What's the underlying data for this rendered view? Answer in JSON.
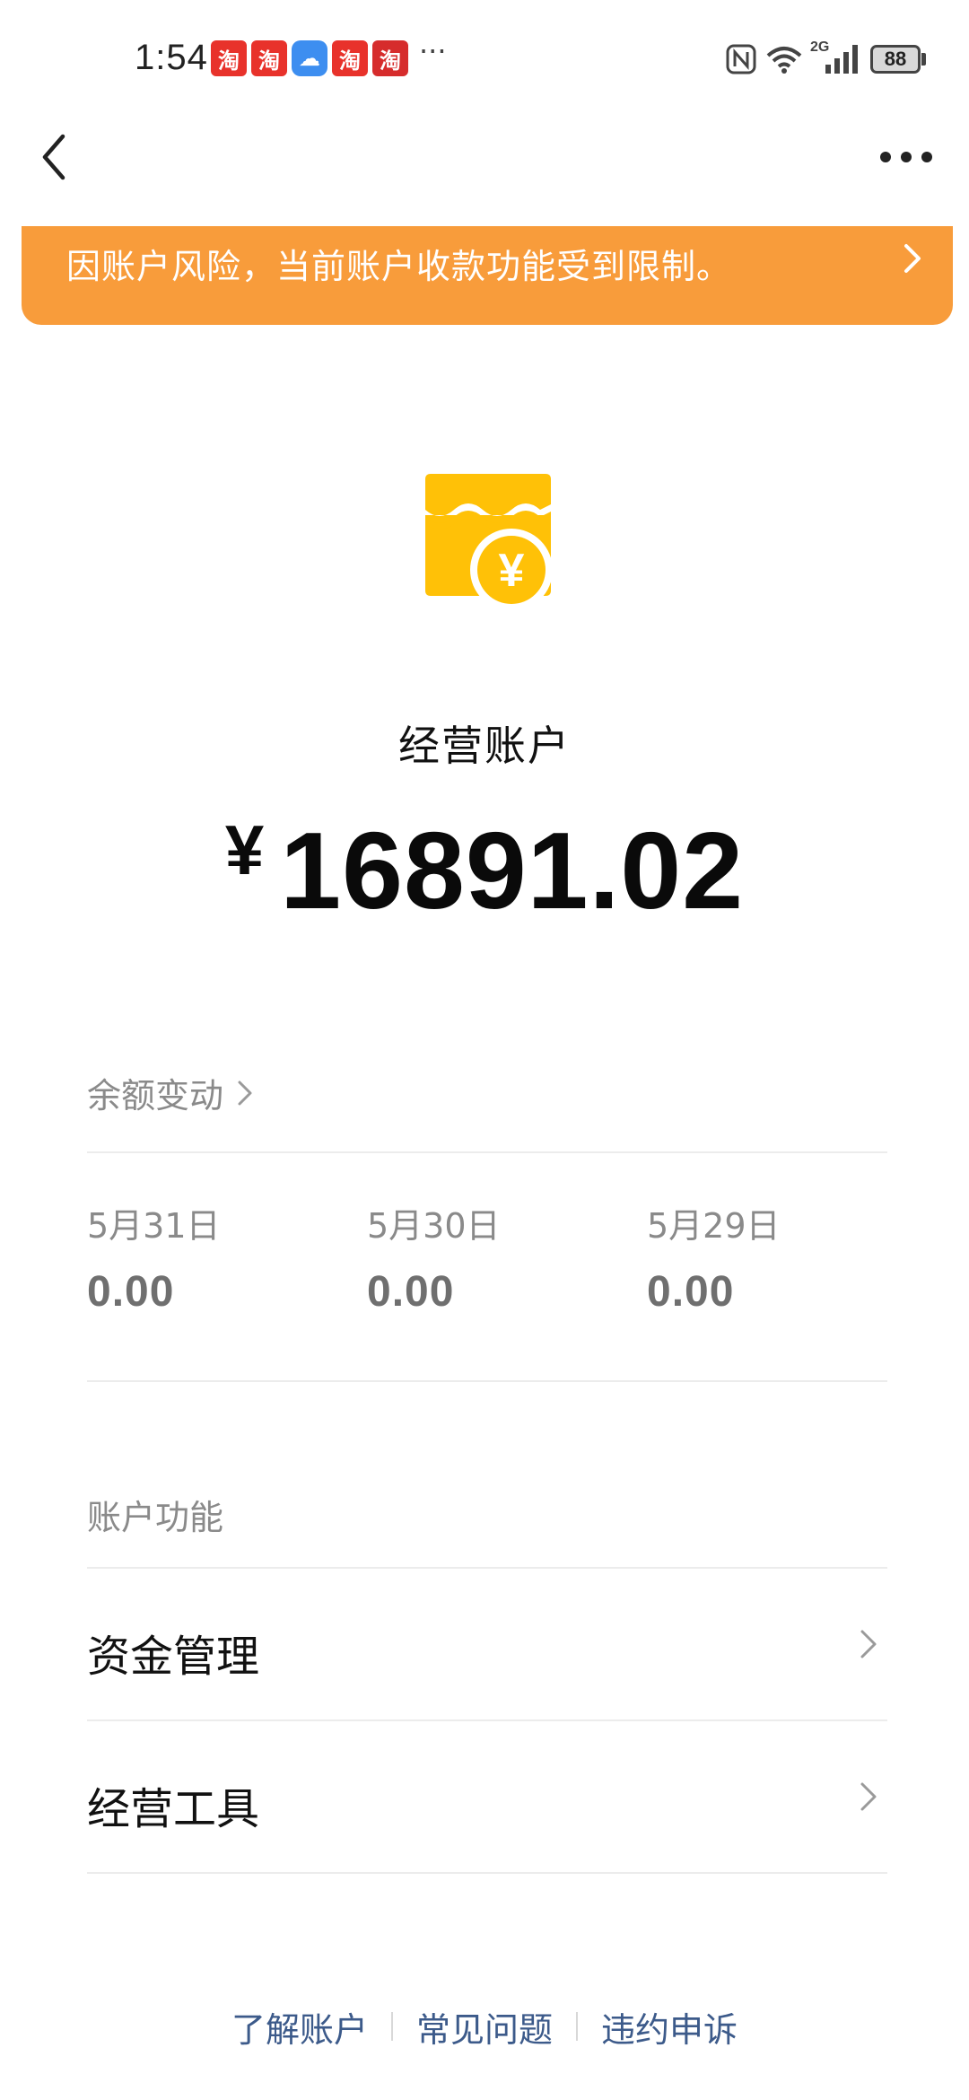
{
  "status_bar": {
    "time": "1:54",
    "notifications": [
      {
        "name": "taobao-618-icon",
        "glyph": "淘",
        "color": "#e8322b"
      },
      {
        "name": "taobao-618-icon",
        "glyph": "淘",
        "color": "#e8322b"
      },
      {
        "name": "cloud-app-icon",
        "glyph": "☁",
        "color": "#3d8ef0"
      },
      {
        "name": "taobao-618-icon",
        "glyph": "淘",
        "color": "#e8322b"
      },
      {
        "name": "taobao-icon",
        "glyph": "淘",
        "color": "#d62c2c"
      }
    ],
    "more": "···",
    "network": "2G",
    "battery": "88"
  },
  "warning": {
    "text": "因账户风险，当前账户收款功能受到限制。"
  },
  "account": {
    "title": "经营账户",
    "currency": "¥",
    "balance": "16891.02"
  },
  "balance_changes": {
    "label": "余额变动",
    "days": [
      {
        "date": "5月31日",
        "value": "0.00"
      },
      {
        "date": "5月30日",
        "value": "0.00"
      },
      {
        "date": "5月29日",
        "value": "0.00"
      }
    ]
  },
  "features": {
    "title": "账户功能",
    "items": [
      {
        "label": "资金管理"
      },
      {
        "label": "经营工具"
      }
    ]
  },
  "footer": {
    "links": [
      "了解账户",
      "常见问题",
      "违约申诉"
    ]
  },
  "colors": {
    "banner": "#f89c3b",
    "shop_icon": "#ffc107",
    "footer_link": "#3c5a8a"
  }
}
